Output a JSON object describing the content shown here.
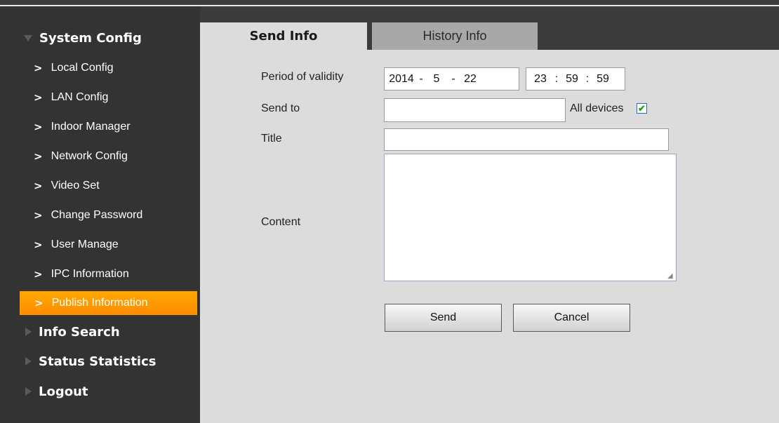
{
  "sidebar": {
    "sections": [
      {
        "label": "System Config",
        "expanded": true
      },
      {
        "label": "Info Search",
        "expanded": false
      },
      {
        "label": "Status Statistics",
        "expanded": false
      },
      {
        "label": "Logout",
        "expanded": false
      }
    ],
    "items": [
      {
        "label": "Local Config"
      },
      {
        "label": "LAN Config"
      },
      {
        "label": "Indoor Manager"
      },
      {
        "label": "Network Config"
      },
      {
        "label": "Video Set"
      },
      {
        "label": "Change Password"
      },
      {
        "label": "User Manage"
      },
      {
        "label": "IPC Information"
      },
      {
        "label": "Publish Information",
        "active": true
      }
    ],
    "chevron": ">"
  },
  "tabs": [
    {
      "label": "Send Info",
      "active": true
    },
    {
      "label": "History Info",
      "active": false
    }
  ],
  "form": {
    "validity_label": "Period of validity",
    "date": {
      "year": "2014",
      "month": "5",
      "day": "22",
      "sep1": "-",
      "sep2": "-"
    },
    "time": {
      "hour": "23",
      "minute": "59",
      "second": "59",
      "sep": ":"
    },
    "send_to_label": "Send to",
    "send_to_value": "",
    "all_devices_label": "All devices",
    "all_devices_checked": true,
    "check_glyph": "✔",
    "title_label": "Title",
    "title_value": "",
    "content_label": "Content",
    "content_value": ""
  },
  "buttons": {
    "send": "Send",
    "cancel": "Cancel"
  },
  "colors": {
    "sidebar_bg": "#333333",
    "active_item": "#ff9a00",
    "content_bg": "#dcdcdc",
    "tab_inactive": "#a8a8a8"
  }
}
